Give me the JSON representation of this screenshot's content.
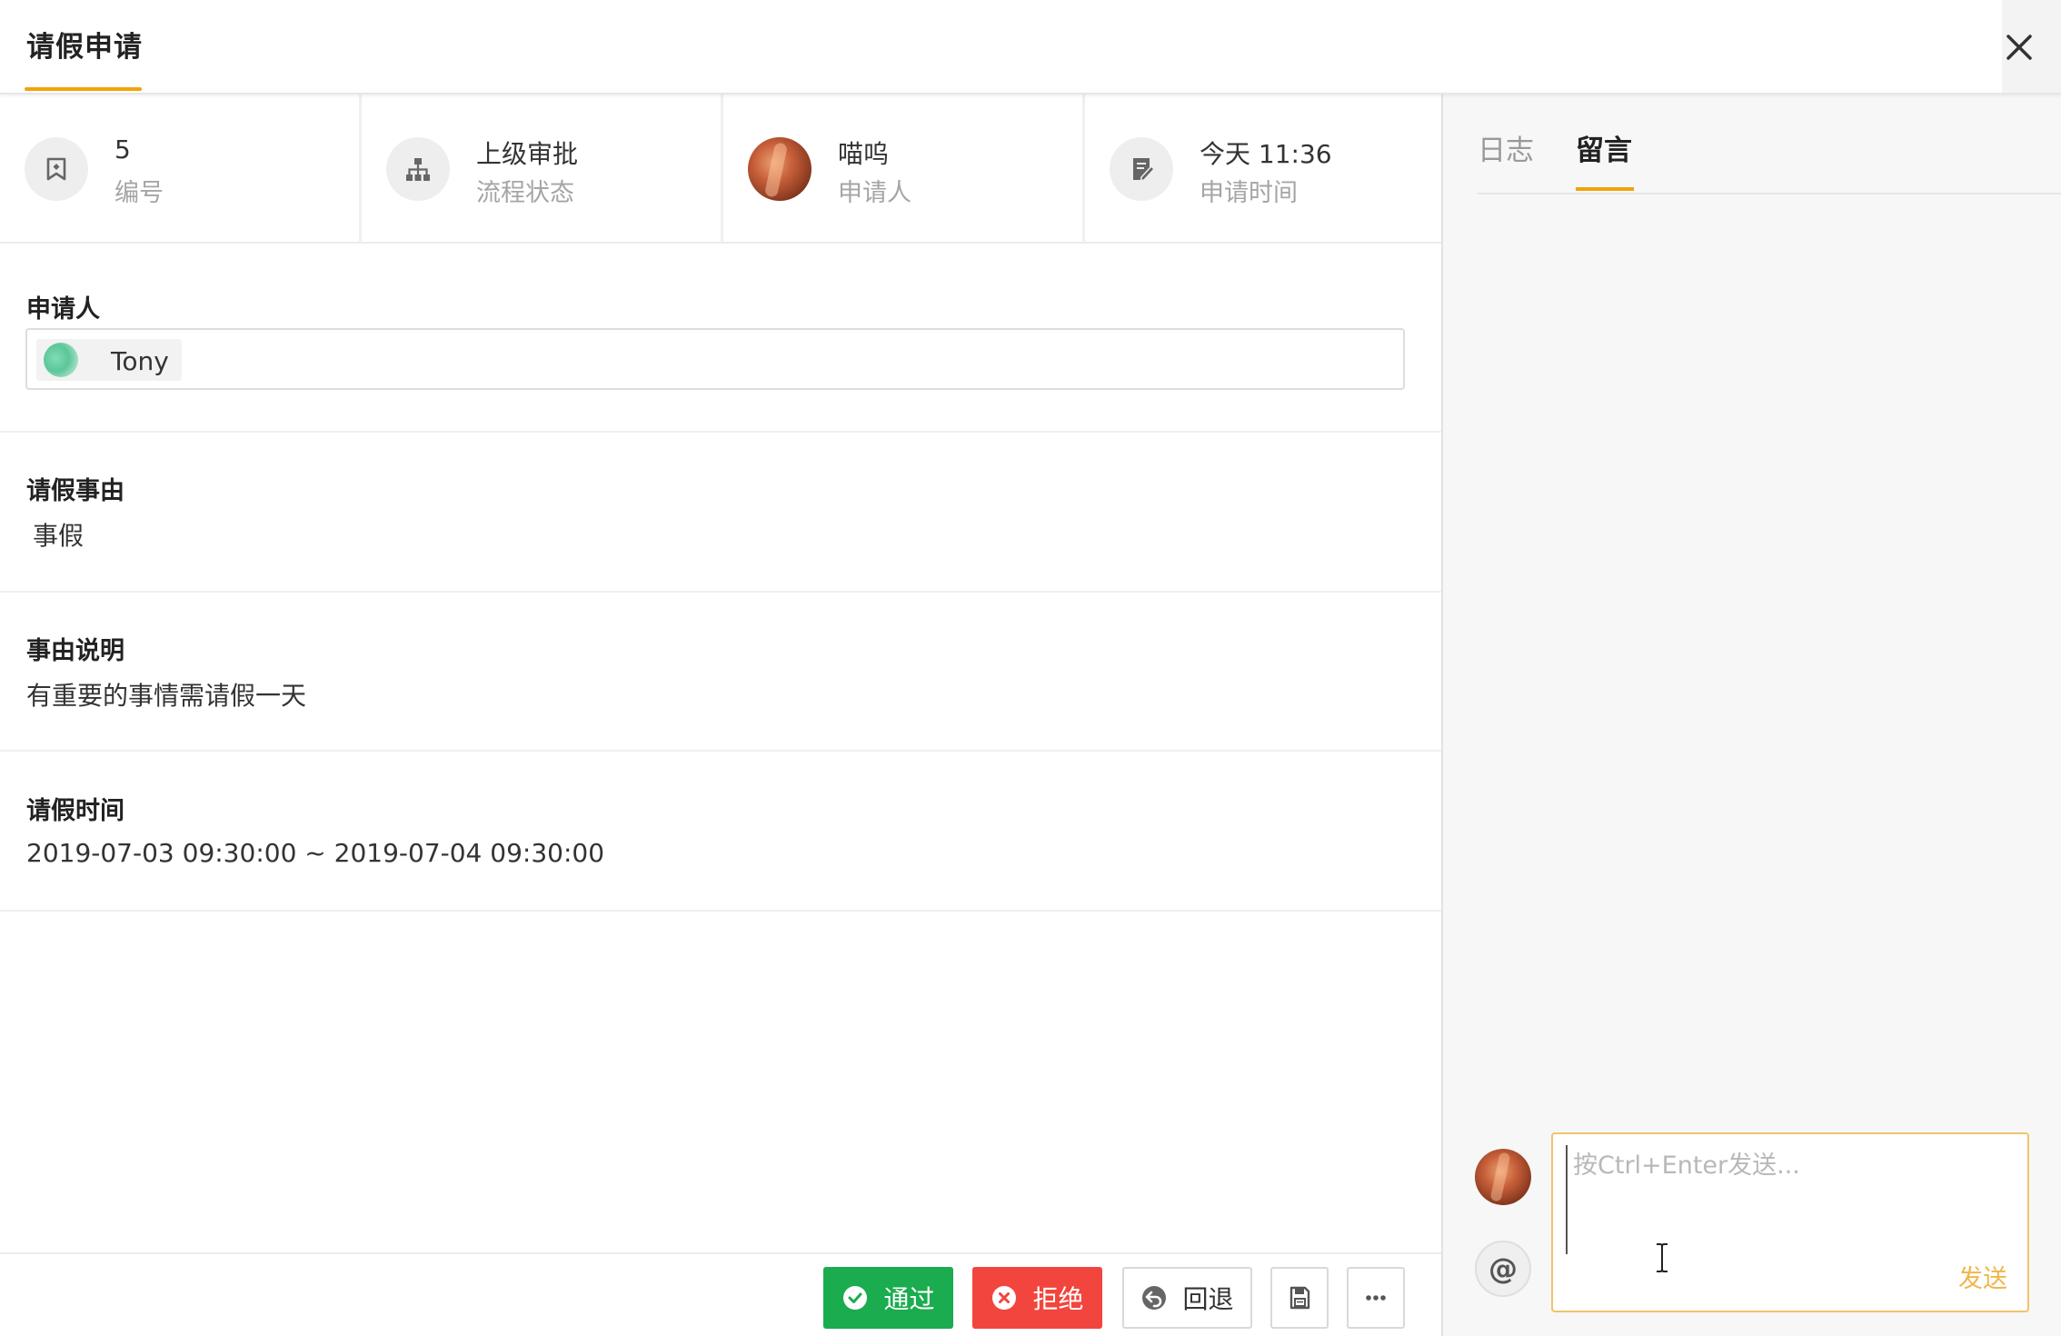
{
  "header": {
    "title": "请假申请"
  },
  "info_cards": [
    {
      "value": "5",
      "label": "编号",
      "icon": "tag-icon"
    },
    {
      "value": "上级审批",
      "label": "流程状态",
      "icon": "org-chart-icon"
    },
    {
      "value": "喵呜",
      "label": "申请人",
      "icon": "avatar"
    },
    {
      "value": "今天 11:36",
      "label": "申请时间",
      "icon": "edit-doc-icon"
    }
  ],
  "fields": {
    "applicant": {
      "title": "申请人",
      "user": "Tony"
    },
    "reason": {
      "title": "请假事由",
      "value": "事假"
    },
    "description": {
      "title": "事由说明",
      "value": "有重要的事情需请假一天"
    },
    "time": {
      "title": "请假时间",
      "value": "2019-07-03 09:30:00 ~ 2019-07-04 09:30:00"
    }
  },
  "actions": {
    "pass": "通过",
    "reject": "拒绝",
    "back": "回退",
    "save_icon": "save-icon",
    "more_icon": "more-icon"
  },
  "sidebar": {
    "tabs": [
      "日志",
      "留言"
    ],
    "active_tab": "留言",
    "composer": {
      "placeholder": "按Ctrl+Enter发送...",
      "send": "发送",
      "at": "@"
    }
  },
  "colors": {
    "accent": "#f0a30a",
    "pass": "#1aac4f",
    "reject": "#f2453d",
    "send": "#f0b64a"
  }
}
